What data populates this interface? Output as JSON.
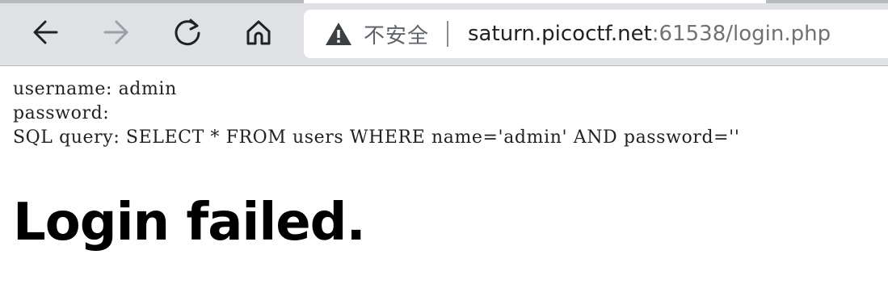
{
  "browser": {
    "nav": {
      "back_icon": "arrow-left-icon",
      "forward_icon": "arrow-right-icon",
      "reload_icon": "reload-icon",
      "home_icon": "home-icon"
    },
    "omnibox": {
      "security_icon": "warning-triangle-icon",
      "security_label": "不安全",
      "url_host": "saturn.picoctf.net",
      "url_rest": ":61538/login.php"
    },
    "colors": {
      "toolbar_bg": "#dfe1e5",
      "disabled_icon": "#9aa0a6",
      "active_icon": "#202124"
    }
  },
  "page": {
    "lines": [
      "username: admin",
      "password:",
      "SQL query: SELECT * FROM users WHERE name='admin' AND password=''"
    ],
    "heading": "Login failed."
  }
}
